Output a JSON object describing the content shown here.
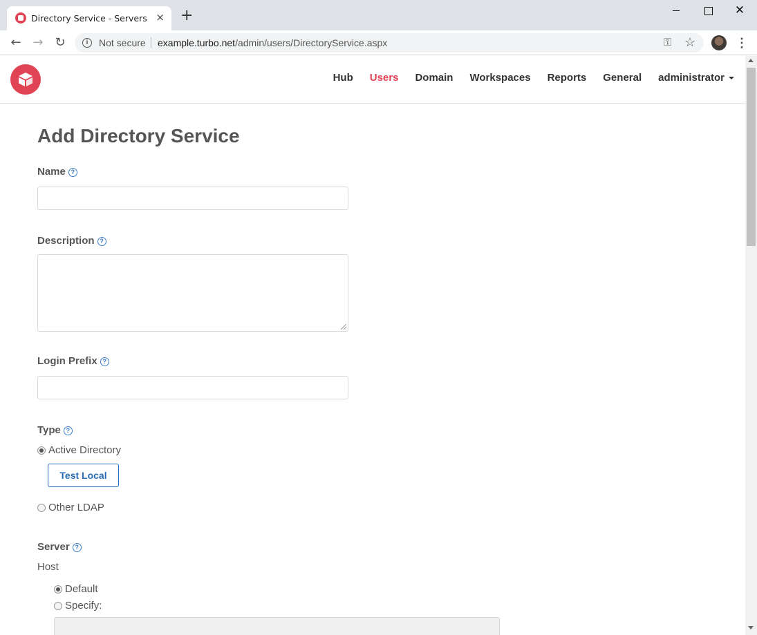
{
  "browser": {
    "tab_title": "Directory Service - Servers",
    "tab_close": "×",
    "new_tab": "+",
    "not_secure": "Not secure",
    "url_host": "example.turbo.net",
    "url_path": "/admin/users/DirectoryService.aspx"
  },
  "nav": {
    "items": [
      {
        "label": "Hub",
        "active": false
      },
      {
        "label": "Users",
        "active": true
      },
      {
        "label": "Domain",
        "active": false
      },
      {
        "label": "Workspaces",
        "active": false
      },
      {
        "label": "Reports",
        "active": false
      },
      {
        "label": "General",
        "active": false
      }
    ],
    "user": "administrator"
  },
  "form": {
    "title": "Add Directory Service",
    "name_label": "Name",
    "name_value": "",
    "description_label": "Description",
    "description_value": "",
    "login_prefix_label": "Login Prefix",
    "login_prefix_value": "",
    "type_label": "Type",
    "type_options": [
      {
        "label": "Active Directory",
        "checked": true
      },
      {
        "label": "Other LDAP",
        "checked": false
      }
    ],
    "test_local_button": "Test Local",
    "server_label": "Server",
    "host_label": "Host",
    "host_options": [
      {
        "label": "Default",
        "checked": true
      },
      {
        "label": "Specify:",
        "checked": false
      }
    ],
    "host_value": ""
  },
  "help_glyph": "?",
  "colors": {
    "brand": "#e04454",
    "link": "#2a6cb8",
    "help": "#3a7dc9"
  }
}
